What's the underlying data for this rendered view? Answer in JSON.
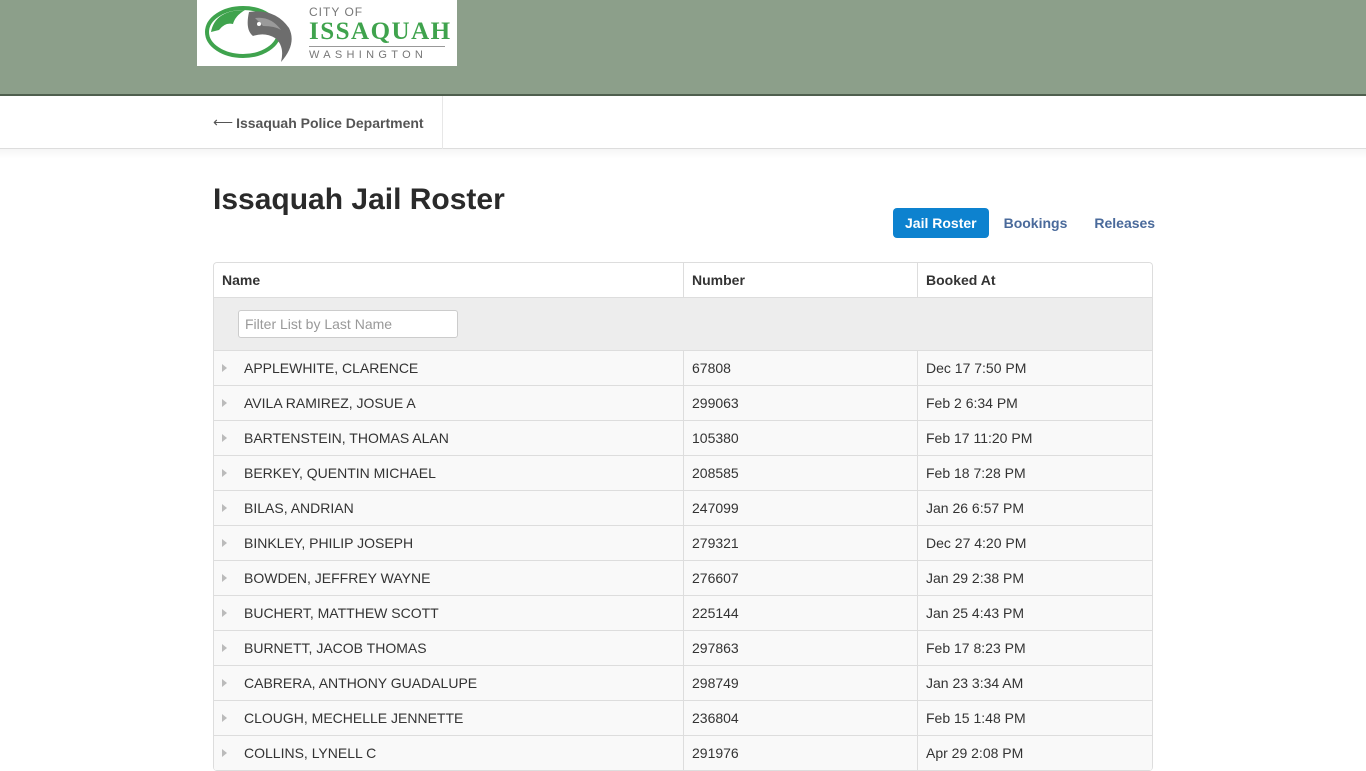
{
  "logo": {
    "city_of": "CITY OF",
    "name": "ISSAQUAH",
    "state": "WASHINGTON",
    "brand_green": "#3fa34d"
  },
  "nav": {
    "back_arrow": "⟵",
    "back_label": "Issaquah Police Department"
  },
  "page": {
    "title": "Issaquah Jail Roster"
  },
  "tabs": [
    {
      "label": "Jail Roster",
      "active": true
    },
    {
      "label": "Bookings",
      "active": false
    },
    {
      "label": "Releases",
      "active": false
    }
  ],
  "table": {
    "columns": [
      "Name",
      "Number",
      "Booked At"
    ],
    "filter_placeholder": "Filter List by Last Name",
    "filter_value": "",
    "rows": [
      {
        "name": "APPLEWHITE, CLARENCE",
        "number": "67808",
        "booked_at": "Dec 17 7:50 PM"
      },
      {
        "name": "AVILA RAMIREZ, JOSUE A",
        "number": "299063",
        "booked_at": "Feb 2 6:34 PM"
      },
      {
        "name": "BARTENSTEIN, THOMAS ALAN",
        "number": "105380",
        "booked_at": "Feb 17 11:20 PM"
      },
      {
        "name": "BERKEY, QUENTIN MICHAEL",
        "number": "208585",
        "booked_at": "Feb 18 7:28 PM"
      },
      {
        "name": "BILAS, ANDRIAN",
        "number": "247099",
        "booked_at": "Jan 26 6:57 PM"
      },
      {
        "name": "BINKLEY, PHILIP JOSEPH",
        "number": "279321",
        "booked_at": "Dec 27 4:20 PM"
      },
      {
        "name": "BOWDEN, JEFFREY WAYNE",
        "number": "276607",
        "booked_at": "Jan 29 2:38 PM"
      },
      {
        "name": "BUCHERT, MATTHEW SCOTT",
        "number": "225144",
        "booked_at": "Jan 25 4:43 PM"
      },
      {
        "name": "BURNETT, JACOB THOMAS",
        "number": "297863",
        "booked_at": "Feb 17 8:23 PM"
      },
      {
        "name": "CABRERA, ANTHONY GUADALUPE",
        "number": "298749",
        "booked_at": "Jan 23 3:34 AM"
      },
      {
        "name": "CLOUGH, MECHELLE JENNETTE",
        "number": "236804",
        "booked_at": "Feb 15 1:48 PM"
      },
      {
        "name": "COLLINS, LYNELL C",
        "number": "291976",
        "booked_at": "Apr 29 2:08 PM"
      }
    ]
  },
  "colors": {
    "banner": "#8c9f8a",
    "active_tab": "#0d82cf",
    "tab_link": "#4a6a9b"
  }
}
